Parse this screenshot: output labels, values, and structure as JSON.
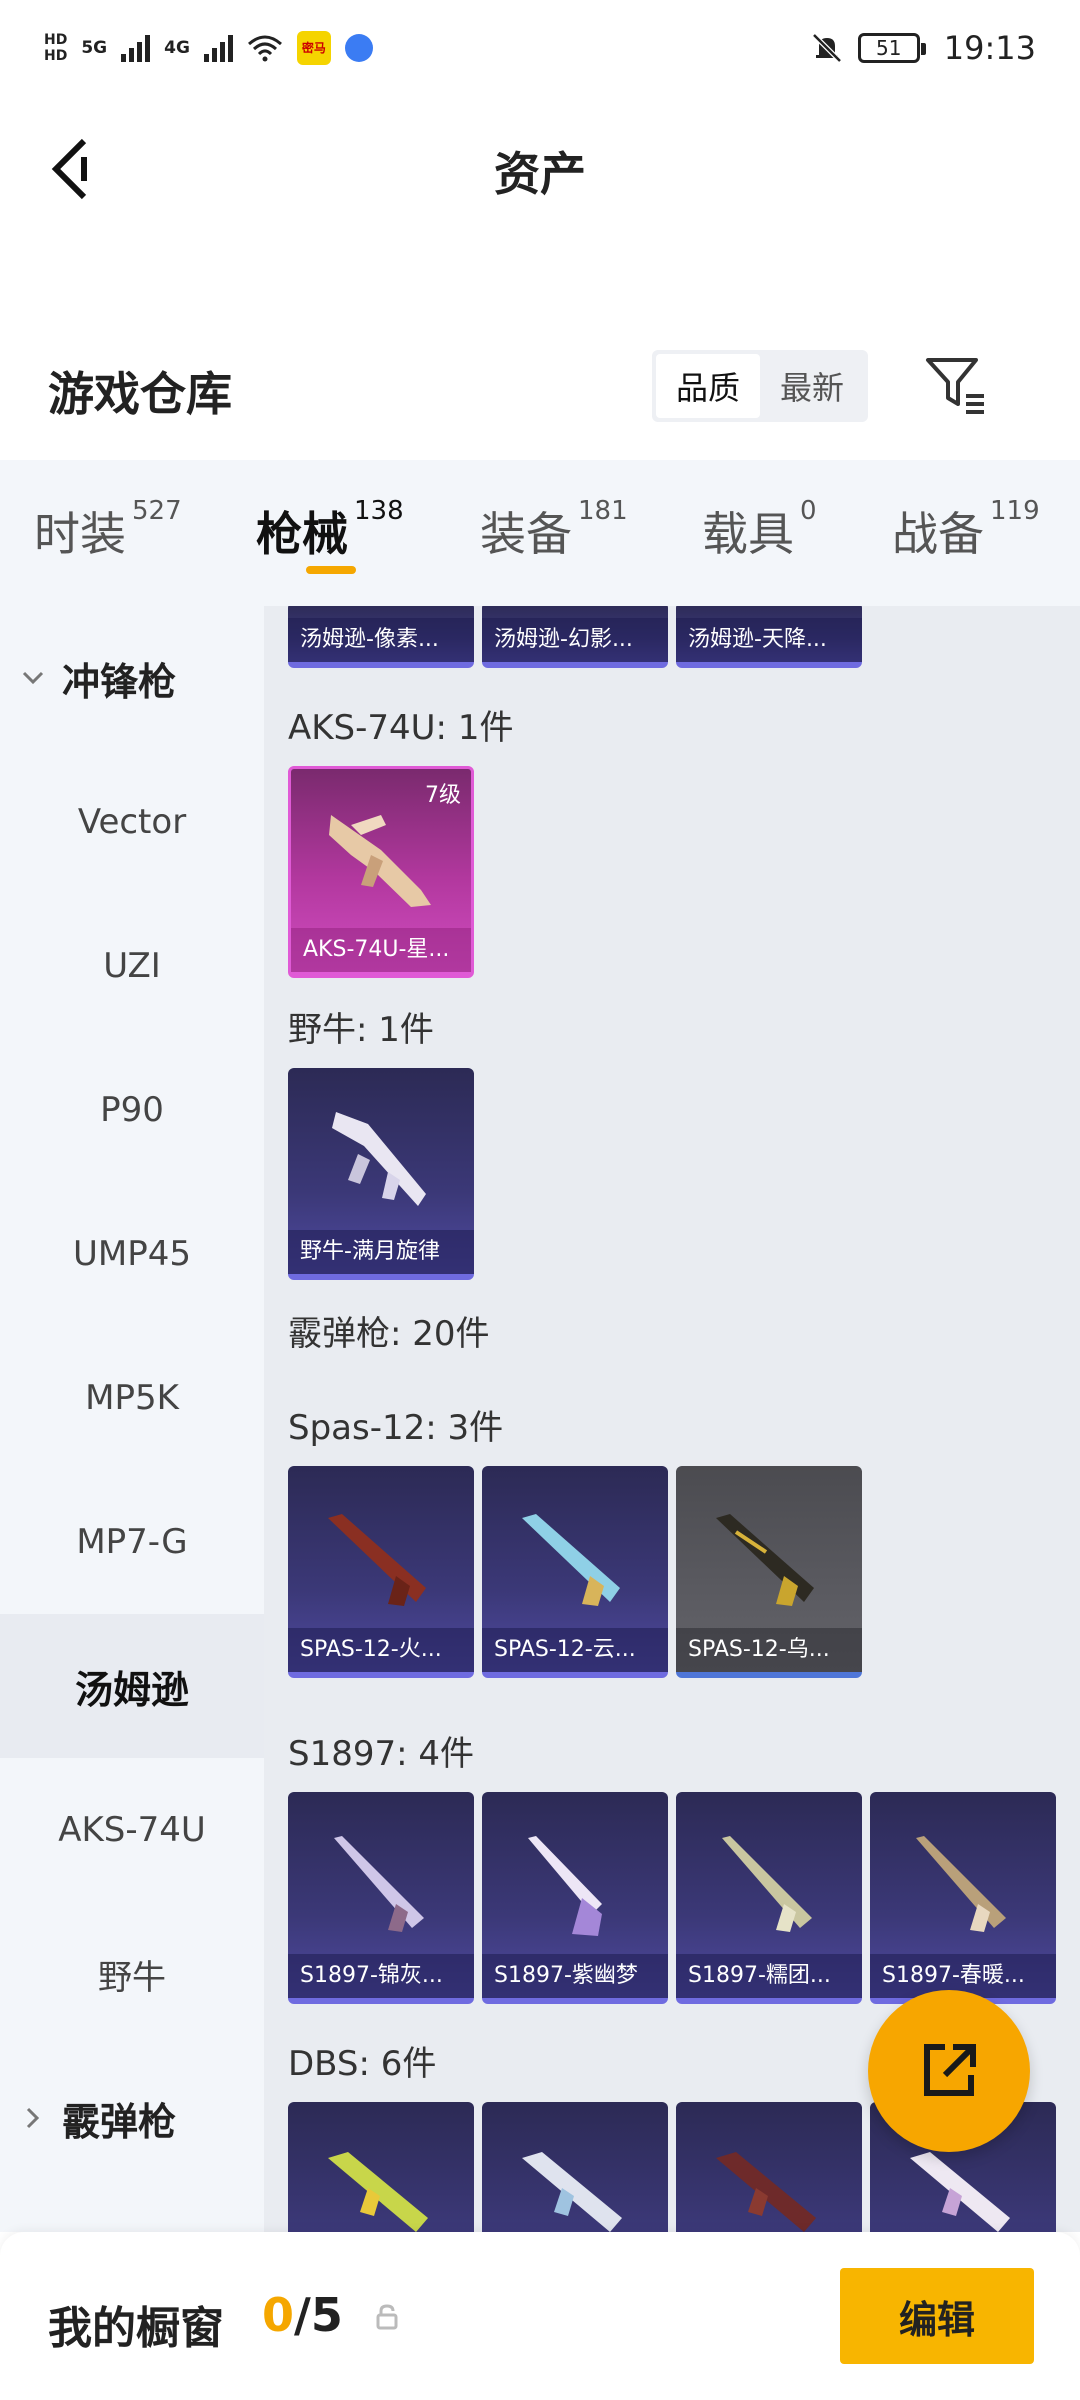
{
  "status_bar": {
    "hd1": "HD",
    "hd2": "HD",
    "net1": "5G",
    "net2": "4G",
    "app_badge": "密马",
    "battery": "51",
    "time": "19:13"
  },
  "header": {
    "title": "资产"
  },
  "warehouse": {
    "title": "游戏仓库",
    "sort_options": [
      "品质",
      "最新"
    ],
    "active_sort": "品质"
  },
  "tabs": [
    {
      "label": "时装",
      "count": "527"
    },
    {
      "label": "枪械",
      "count": "138"
    },
    {
      "label": "装备",
      "count": "181"
    },
    {
      "label": "载具",
      "count": "0"
    },
    {
      "label": "战备",
      "count": "119"
    }
  ],
  "active_tab": "枪械",
  "sidebar": {
    "group_expanded": "冲锋枪",
    "items": [
      "Vector",
      "UZI",
      "P90",
      "UMP45",
      "MP5K",
      "MP7-G",
      "汤姆逊",
      "AKS-74U",
      "野牛"
    ],
    "active_item": "汤姆逊",
    "group_collapsed": "霰弹枪"
  },
  "sections": {
    "top_cards": [
      "汤姆逊-像素...",
      "汤姆逊-幻影...",
      "汤姆逊-天降..."
    ],
    "aks": {
      "label": "AKS-74U: 1件",
      "cards": [
        {
          "name": "AKS-74U-星...",
          "level": "7级"
        }
      ]
    },
    "bison": {
      "label": "野牛: 1件",
      "cards": [
        {
          "name": "野牛-满月旋律"
        }
      ]
    },
    "shotgun_label": "霰弹枪: 20件",
    "spas": {
      "label": "Spas-12: 3件",
      "cards": [
        {
          "name": "SPAS-12-火..."
        },
        {
          "name": "SPAS-12-云..."
        },
        {
          "name": "SPAS-12-乌..."
        }
      ]
    },
    "s1897": {
      "label": "S1897: 4件",
      "cards": [
        {
          "name": "S1897-锦灰..."
        },
        {
          "name": "S1897-紫幽梦"
        },
        {
          "name": "S1897-糯团..."
        },
        {
          "name": "S1897-春暖..."
        }
      ]
    },
    "dbs": {
      "label": "DBS: 6件"
    }
  },
  "bottom": {
    "showcase_label": "我的橱窗",
    "current": "0",
    "separator": "/",
    "total": "5",
    "edit_label": "编辑"
  },
  "colors": {
    "accent": "#f5a700",
    "edit_button": "#f8b500",
    "card_blue": "#3b3877",
    "card_purple": "#b3389f",
    "card_gray": "#5a5a60"
  },
  "icons": [
    "back-arrow-icon",
    "filter-icon",
    "chevron-down-icon",
    "chevron-right-icon",
    "share-icon",
    "lock-icon",
    "mute-bell-icon"
  ]
}
